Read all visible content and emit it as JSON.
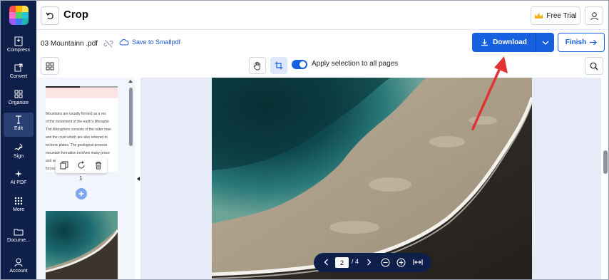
{
  "app": {
    "title": "Crop"
  },
  "colors": {
    "nav_bg": "#0e1f4a",
    "accent": "#1761e0",
    "annotation": "#e23232"
  },
  "leftnav": {
    "items": [
      {
        "label": "Compress",
        "icon": "compress-icon"
      },
      {
        "label": "Convert",
        "icon": "convert-icon"
      },
      {
        "label": "Organize",
        "icon": "organize-icon"
      },
      {
        "label": "Edit",
        "icon": "edit-icon",
        "active": true
      },
      {
        "label": "Sign",
        "icon": "sign-icon"
      },
      {
        "label": "AI PDF",
        "icon": "sparkle-icon"
      },
      {
        "label": "More",
        "icon": "grid-dots-icon"
      },
      {
        "label": "Docume...",
        "icon": "folder-icon"
      },
      {
        "label": "Account",
        "icon": "person-icon"
      }
    ]
  },
  "header": {
    "free_trial_label": "Free Trial"
  },
  "file": {
    "name": "03 Mountainn .pdf",
    "save_label": "Save to Smallpdf"
  },
  "actions": {
    "download_label": "Download",
    "finish_label": "Finish"
  },
  "toolbar": {
    "apply_label": "Apply selection to all pages",
    "apply_enabled": true
  },
  "thumbnails": {
    "page1_text": [
      "Mountains are usually formed as a res",
      "of the movement of the earth's lithosphe",
      "The lithosphere consists of the outer man",
      "and the crust which are also referred to",
      "tectonic plates. The geological process",
      "mountain formation involves many proce",
      "and ac",
      "forces"
    ],
    "page1_number": "1"
  },
  "pager": {
    "current_page": "2",
    "total_label": "/ 4"
  }
}
